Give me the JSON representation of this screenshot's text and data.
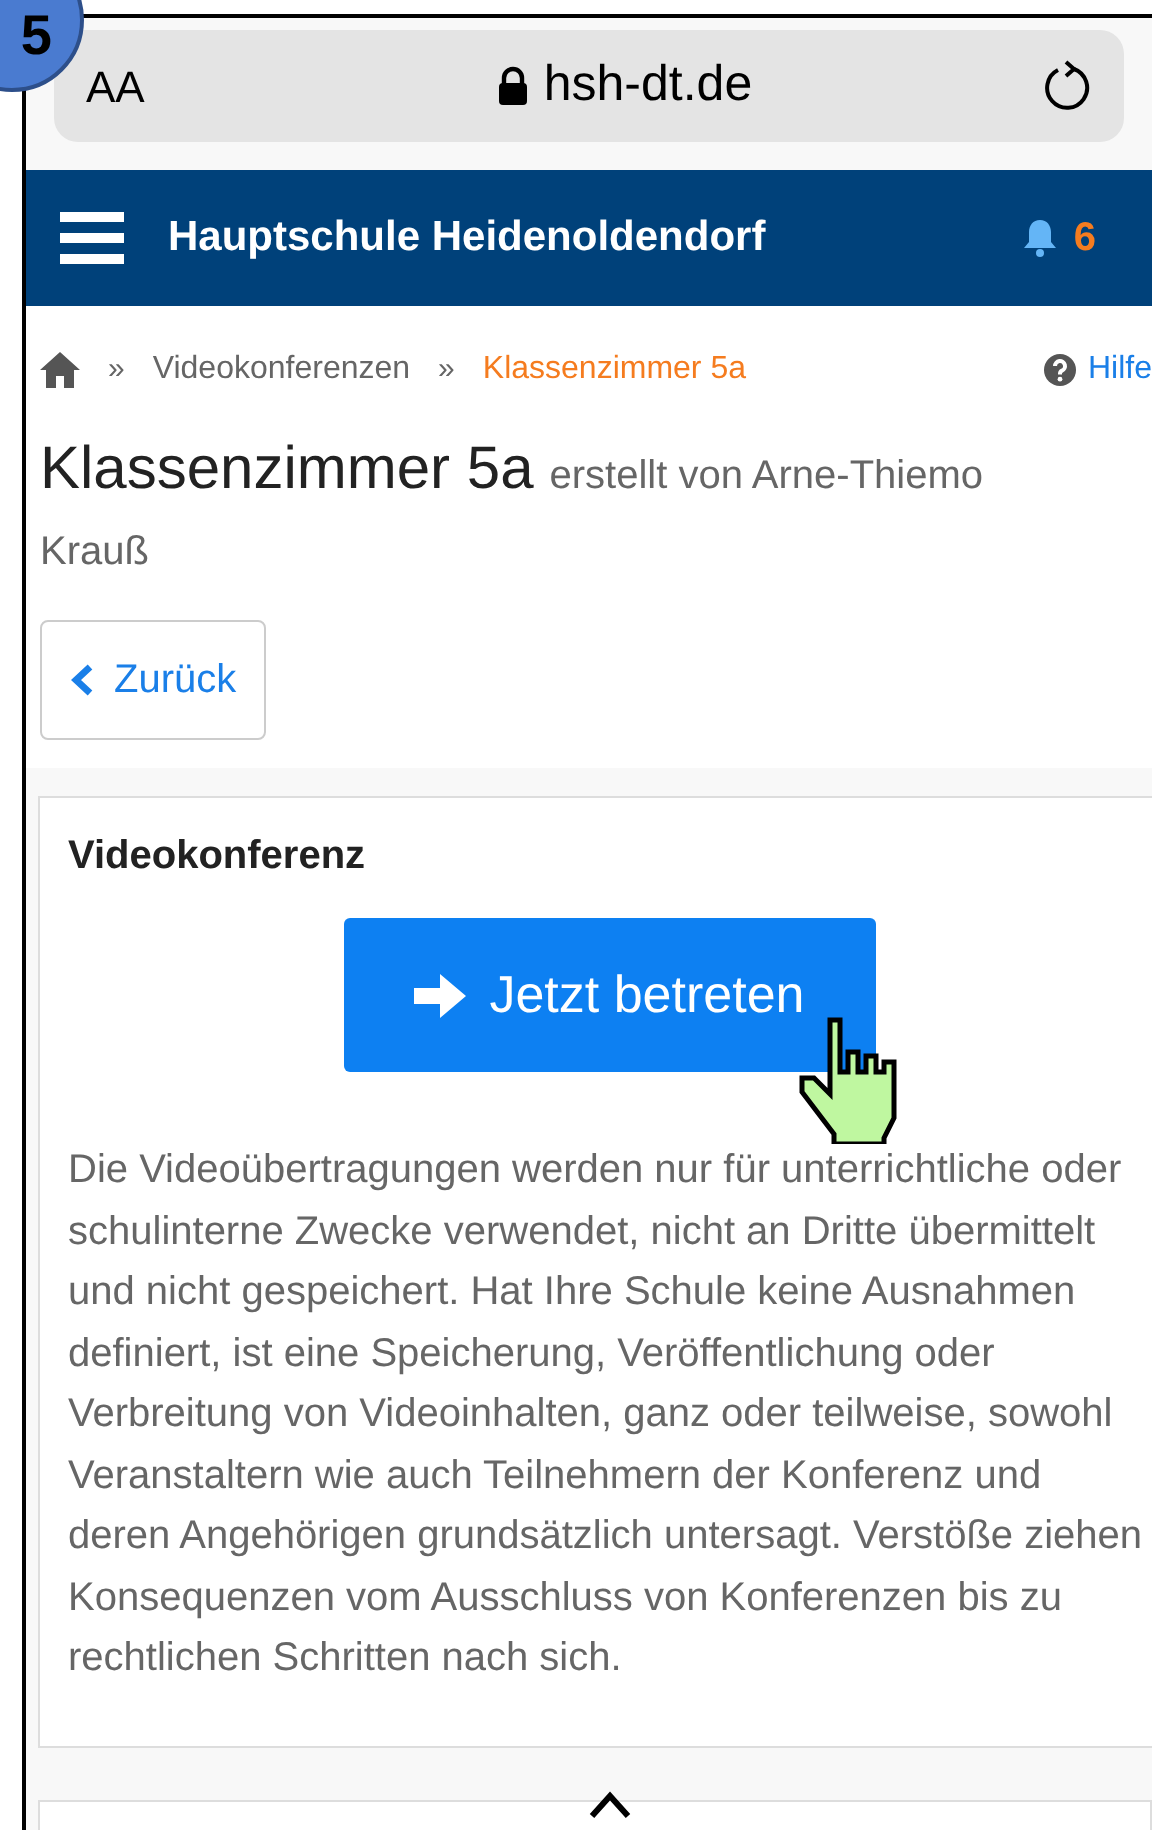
{
  "step_badge": "5",
  "browser": {
    "text_size": "AA",
    "url": "hsh-dt.de"
  },
  "header": {
    "title": "Hauptschule Heidenoldendorf",
    "notifications": "6"
  },
  "breadcrumb": {
    "items": [
      {
        "label": "Videokonferenzen",
        "current": false
      },
      {
        "label": "Klassenzimmer 5a",
        "current": true
      }
    ],
    "separator": "»",
    "help": "Hilfe"
  },
  "page": {
    "title": "Klassenzimmer 5a",
    "subtitle": "erstellt von Arne-Thiemo Krauß",
    "back": "Zurück"
  },
  "card": {
    "title": "Videokonferenz",
    "button": "Jetzt betreten",
    "text": "Die Videoübertragungen werden nur für unterrichtliche oder schulinterne Zwecke verwendet, nicht an Dritte übermittelt und nicht gespeichert. Hat Ihre Schule keine Ausnahmen definiert, ist eine Speicherung, Veröffentlichung oder Verbreitung von Videoinhalten, ganz oder teilweise, sowohl Veranstaltern wie auch Teilnehmern der Konferenz und deren Angehörigen grundsätzlich untersagt. Verstöße ziehen Konsequenzen vom Ausschluss von Konferenzen bis zu rechtlichen Schritten nach sich."
  }
}
